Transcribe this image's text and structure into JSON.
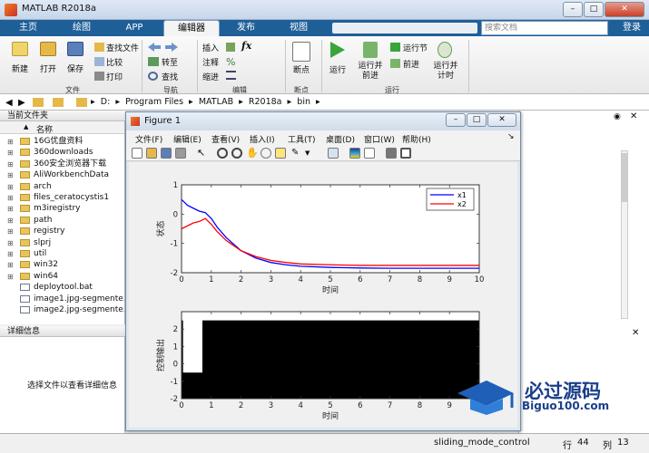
{
  "window": {
    "title": "MATLAB R2018a"
  },
  "tabs": [
    {
      "label": "主页"
    },
    {
      "label": "绘图"
    },
    {
      "label": "APP"
    },
    {
      "label": "编辑器"
    },
    {
      "label": "发布"
    },
    {
      "label": "视图"
    }
  ],
  "search": {
    "placeholder": "搜索文档"
  },
  "login_label": "登录",
  "ribbon": {
    "file_group": {
      "new": "新建",
      "open": "打开",
      "save": "保存",
      "find_files": "查找文件",
      "compare": "比较",
      "print": "打印",
      "label": "文件"
    },
    "nav_group": {
      "goto": "转至",
      "find": "查找",
      "label": "导航"
    },
    "edit_group": {
      "insert": "插入",
      "comment": "注释",
      "indent": "缩进",
      "fx": "fx",
      "label": "编辑"
    },
    "breakpoint_group": {
      "breakpoints": "断点",
      "label": "断点"
    },
    "run_group": {
      "run": "运行",
      "run_advance": "运行并前进",
      "run_section": "运行节",
      "advance": "前进",
      "run_time": "运行并计时",
      "label": "运行"
    }
  },
  "address": {
    "path": [
      "D:",
      "Program Files",
      "MATLAB",
      "R2018a",
      "bin"
    ]
  },
  "current_folder": {
    "header": "当前文件夹",
    "name_col": "名称",
    "items": [
      {
        "name": "16G优盘资料",
        "type": "folder"
      },
      {
        "name": "360downloads",
        "type": "folder"
      },
      {
        "name": "360安全浏览器下载",
        "type": "folder"
      },
      {
        "name": "AliWorkbenchData",
        "type": "folder"
      },
      {
        "name": "arch",
        "type": "folder"
      },
      {
        "name": "files_ceratocystis1",
        "type": "folder"
      },
      {
        "name": "m3iregistry",
        "type": "folder"
      },
      {
        "name": "path",
        "type": "folder"
      },
      {
        "name": "registry",
        "type": "folder"
      },
      {
        "name": "slprj",
        "type": "folder"
      },
      {
        "name": "util",
        "type": "folder"
      },
      {
        "name": "win32",
        "type": "folder"
      },
      {
        "name": "win64",
        "type": "folder"
      },
      {
        "name": "deploytool.bat",
        "type": "file"
      },
      {
        "name": "image1.jpg-segmente...",
        "type": "file"
      },
      {
        "name": "image2.jpg-segmente...",
        "type": "file"
      }
    ]
  },
  "details": {
    "header": "详细信息",
    "message": "选择文件以查看详细信息"
  },
  "figure": {
    "title": "Figure 1",
    "menu": [
      "文件(F)",
      "编辑(E)",
      "查看(V)",
      "插入(I)",
      "工具(T)",
      "桌面(D)",
      "窗口(W)",
      "帮助(H)"
    ]
  },
  "chart_data": [
    {
      "type": "line",
      "xlabel": "时间",
      "ylabel": "状态",
      "xlim": [
        0,
        10
      ],
      "ylim": [
        -2,
        1
      ],
      "xticks": [
        "0",
        "1",
        "2",
        "3",
        "4",
        "5",
        "6",
        "7",
        "8",
        "9",
        "10"
      ],
      "yticks": [
        "1",
        "0",
        "-1",
        "-2"
      ],
      "legend_position": "top-right",
      "series": [
        {
          "name": "x1",
          "color": "#0000ff",
          "x": [
            0,
            0.2,
            0.4,
            0.6,
            0.8,
            1.0,
            1.2,
            1.5,
            2.0,
            2.5,
            3.0,
            3.5,
            4.0,
            5.0,
            6.0,
            7.0,
            8.0,
            9.0,
            10.0
          ],
          "y": [
            0.5,
            0.3,
            0.2,
            0.1,
            0.05,
            -0.15,
            -0.45,
            -0.8,
            -1.25,
            -1.5,
            -1.65,
            -1.73,
            -1.78,
            -1.82,
            -1.84,
            -1.85,
            -1.85,
            -1.85,
            -1.85
          ]
        },
        {
          "name": "x2",
          "color": "#ff0000",
          "x": [
            0,
            0.2,
            0.4,
            0.6,
            0.8,
            1.0,
            1.2,
            1.5,
            2.0,
            2.5,
            3.0,
            3.5,
            4.0,
            5.0,
            6.0,
            7.0,
            8.0,
            9.0,
            10.0
          ],
          "y": [
            -0.5,
            -0.4,
            -0.3,
            -0.25,
            -0.15,
            -0.35,
            -0.6,
            -0.9,
            -1.25,
            -1.45,
            -1.58,
            -1.65,
            -1.7,
            -1.73,
            -1.75,
            -1.75,
            -1.75,
            -1.75,
            -1.75
          ]
        }
      ]
    },
    {
      "type": "area",
      "xlabel": "时间",
      "ylabel": "控制输出",
      "xlim": [
        0,
        10
      ],
      "ylim": [
        -2,
        3
      ],
      "xticks": [
        "0",
        "1",
        "2",
        "3",
        "4",
        "5",
        "6",
        "7",
        "8",
        "9",
        "10"
      ],
      "yticks": [
        "2",
        "1",
        "0",
        "-1",
        "-2"
      ],
      "series": [
        {
          "name": "",
          "color": "#000000",
          "x": [
            0,
            0.05,
            0.05,
            0.7,
            0.7,
            10
          ],
          "y": [
            2.5,
            2.5,
            -0.5,
            -0.5,
            2.5,
            2.5
          ]
        }
      ]
    }
  ],
  "statusbar": {
    "script": "sliding_mode_control",
    "row_label": "行",
    "row": "44",
    "col_label": "列",
    "col": "13"
  },
  "watermark": {
    "text": "必过源码",
    "sub": "Biguo100.com"
  }
}
